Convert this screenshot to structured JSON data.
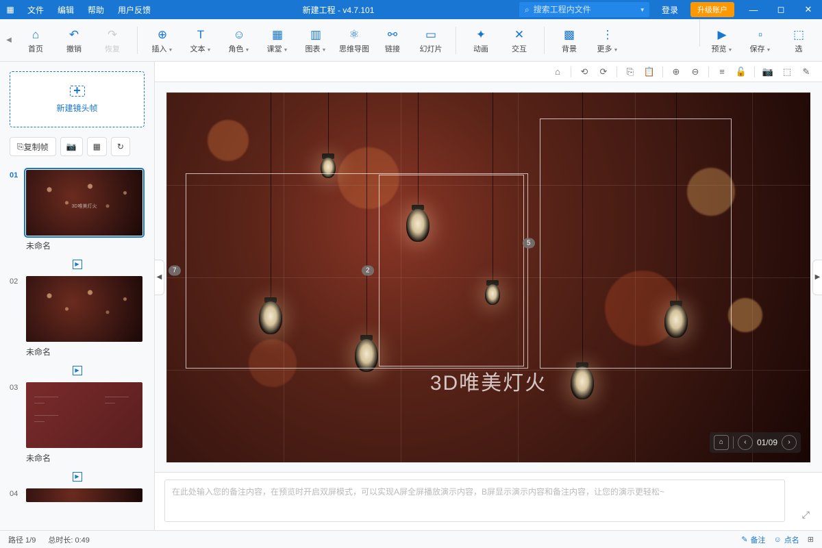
{
  "titlebar": {
    "menus": [
      "文件",
      "编辑",
      "帮助",
      "用户反馈"
    ],
    "title": "新建工程 - v4.7.101",
    "search_placeholder": "搜索工程内文件",
    "login": "登录",
    "upgrade": "升级账户"
  },
  "ribbon": {
    "home": "首页",
    "undo": "撤销",
    "redo": "恢复",
    "insert": "插入",
    "text": "文本",
    "role": "角色",
    "class": "课堂",
    "chart": "图表",
    "mindmap": "思维导图",
    "link": "链接",
    "slide": "幻灯片",
    "anim": "动画",
    "interact": "交互",
    "bg": "背景",
    "more": "更多",
    "preview": "预览",
    "save": "保存",
    "select": "选"
  },
  "sidebar": {
    "newframe": "新建镜头帧",
    "copyframe": "复制帧",
    "slides": [
      {
        "num": "01",
        "name": "未命名",
        "thumb_text": "3D唯美灯火"
      },
      {
        "num": "02",
        "name": "未命名",
        "thumb_text": ""
      },
      {
        "num": "03",
        "name": "未命名",
        "thumb_text": ""
      },
      {
        "num": "04",
        "name": "",
        "thumb_text": ""
      }
    ]
  },
  "canvas": {
    "hero_text": "3D唯美灯火",
    "markers": {
      "m1": "7",
      "m2": "2",
      "m3": "5"
    },
    "pager": {
      "cur": "01",
      "total": "09"
    }
  },
  "notes": {
    "placeholder": "在此处输入您的备注内容，在预览时开启双屏模式，可以实现A屏全屏播放演示内容，B屏显示演示内容和备注内容，让您的演示更轻松~"
  },
  "status": {
    "path": "路径 1/9",
    "duration": "总时长: 0:49",
    "notes": "备注",
    "points": "点名"
  }
}
